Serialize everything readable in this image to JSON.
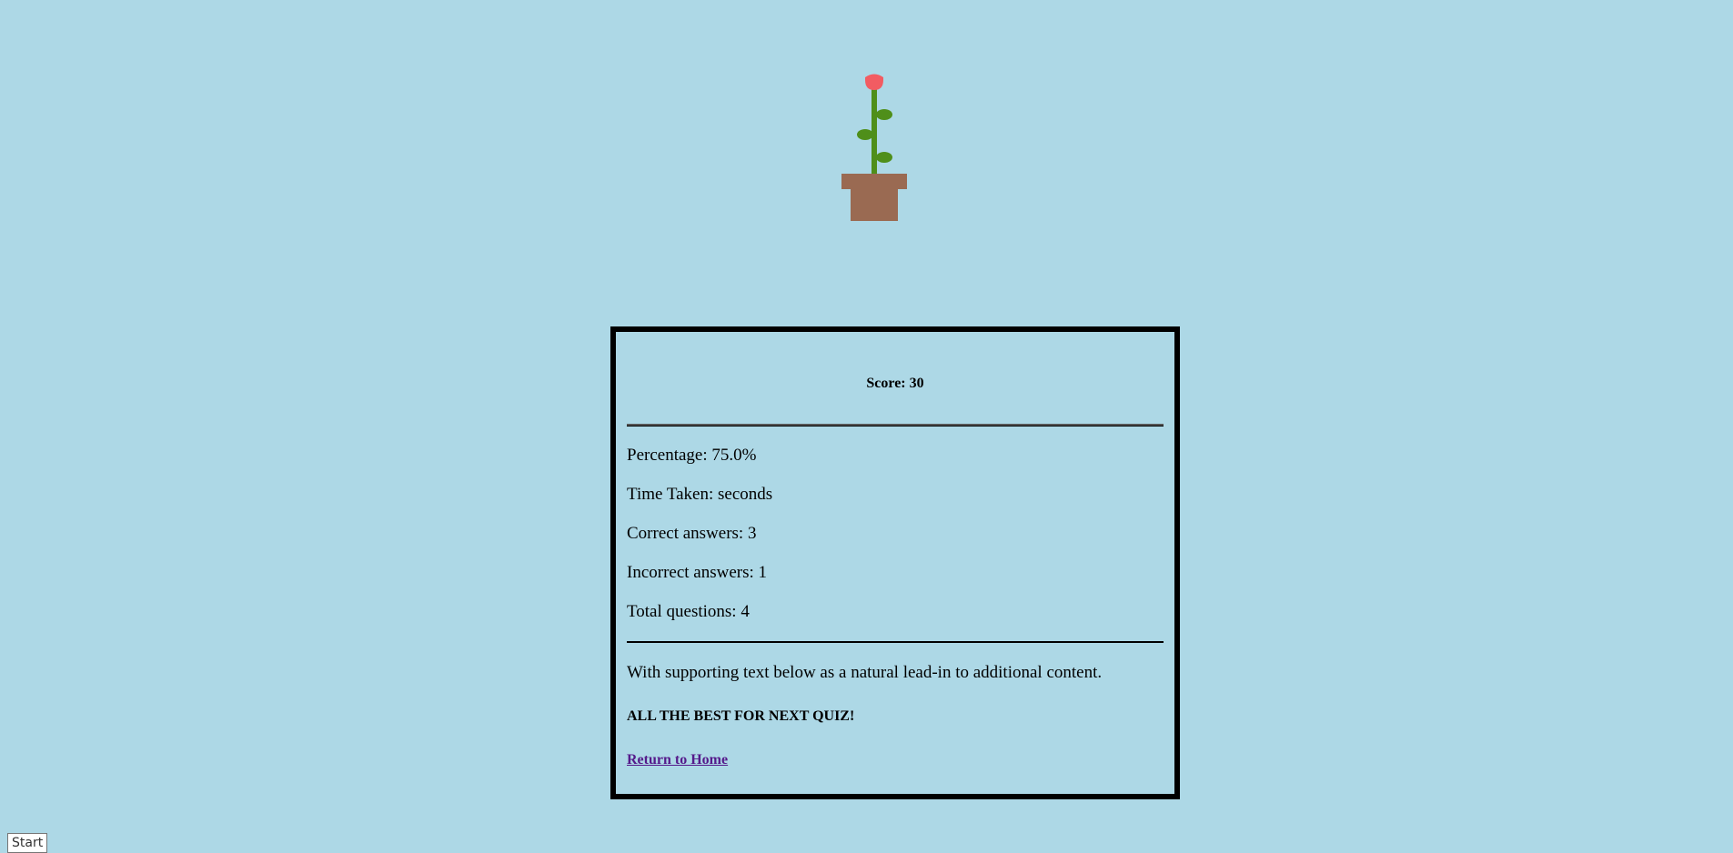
{
  "illustration": {
    "icon": "potted-flower-icon",
    "colors": {
      "flower": "#f25c62",
      "stem": "#4f8f1a",
      "pot": "#9a6a52"
    }
  },
  "result": {
    "score_text": "Score: 30",
    "percentage_text": "Percentage: 75.0%",
    "time_taken_text": "Time Taken: seconds",
    "correct_text": "Correct answers: 3",
    "incorrect_text": "Incorrect answers: 1",
    "total_text": "Total questions: 4",
    "supporting_text": "With supporting text below as a natural lead-in to additional content.",
    "closing_text": "ALL THE BEST FOR NEXT QUIZ!",
    "home_link_label": "Return to Home"
  },
  "taskbar": {
    "start_label": "Start"
  },
  "theme": {
    "background": "#add8e6",
    "link_color": "#551a8b"
  }
}
